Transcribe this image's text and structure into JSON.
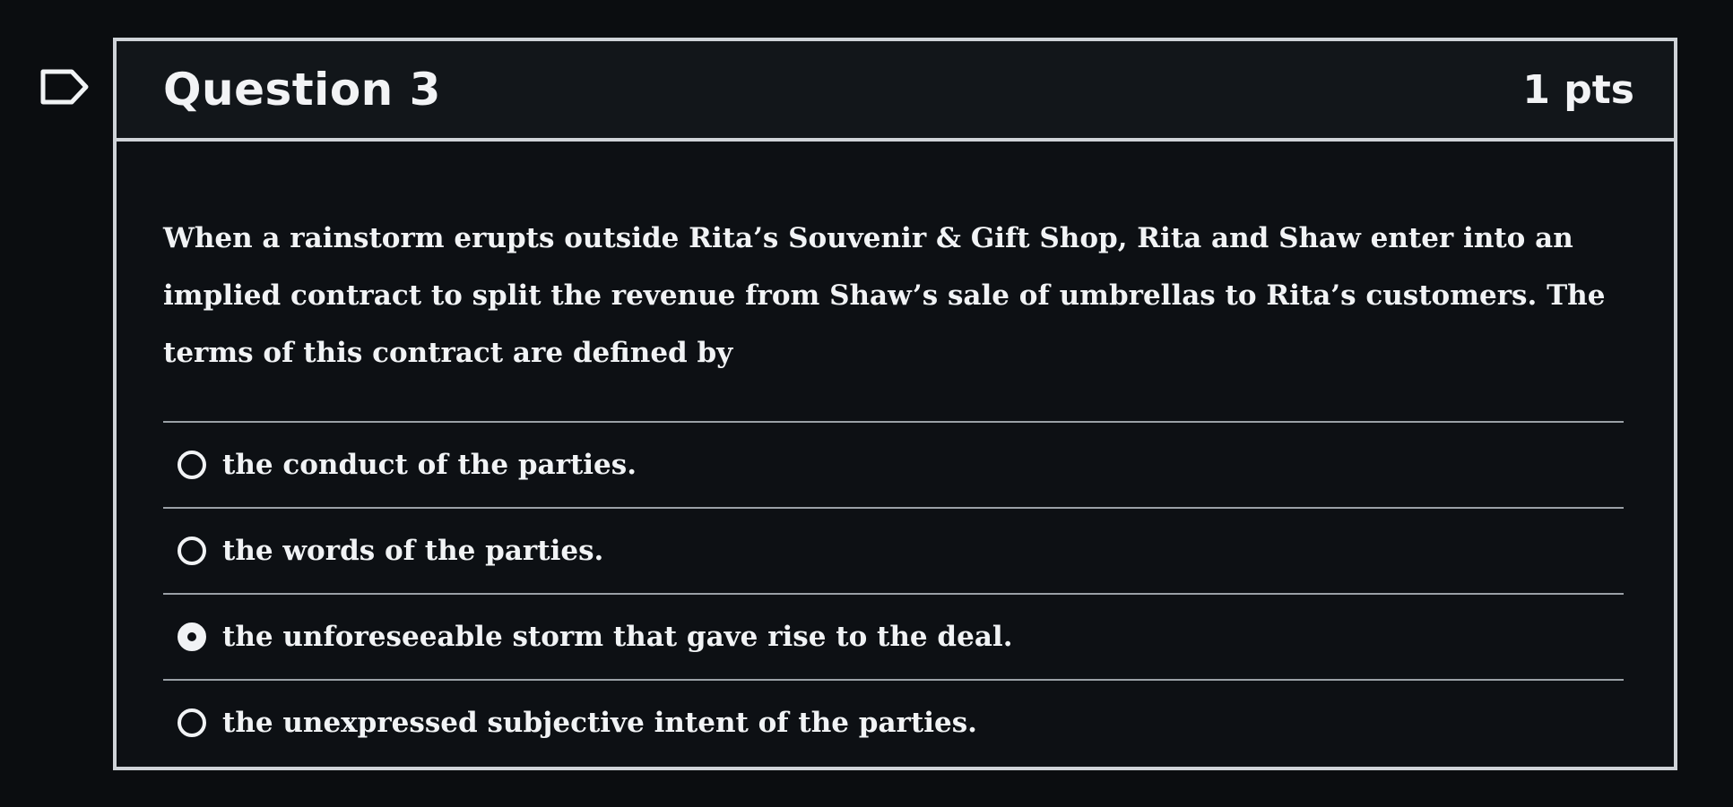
{
  "question": {
    "title": "Question 3",
    "points": "1 pts",
    "text": "When a rainstorm erupts outside Rita’s Souvenir & Gift Shop, Rita and Shaw enter into an implied contract to split the revenue from Shaw’s sale of umbrellas to Rita’s customers. The terms of this contract are defined by"
  },
  "answers": [
    {
      "label": "the conduct of the parties.",
      "selected": false
    },
    {
      "label": "the words of the parties.",
      "selected": false
    },
    {
      "label": "the unforeseeable storm that gave rise to the deal.",
      "selected": true
    },
    {
      "label": "the unexpressed subjective intent of the parties.",
      "selected": false
    }
  ],
  "icons": {
    "flag": "flag-outline-icon",
    "radio": "radio-button-icon"
  },
  "colors": {
    "background": "#0b0d10",
    "border": "#cfd3d8",
    "text": "#f1f3f5",
    "divider": "#9aa0a6"
  }
}
